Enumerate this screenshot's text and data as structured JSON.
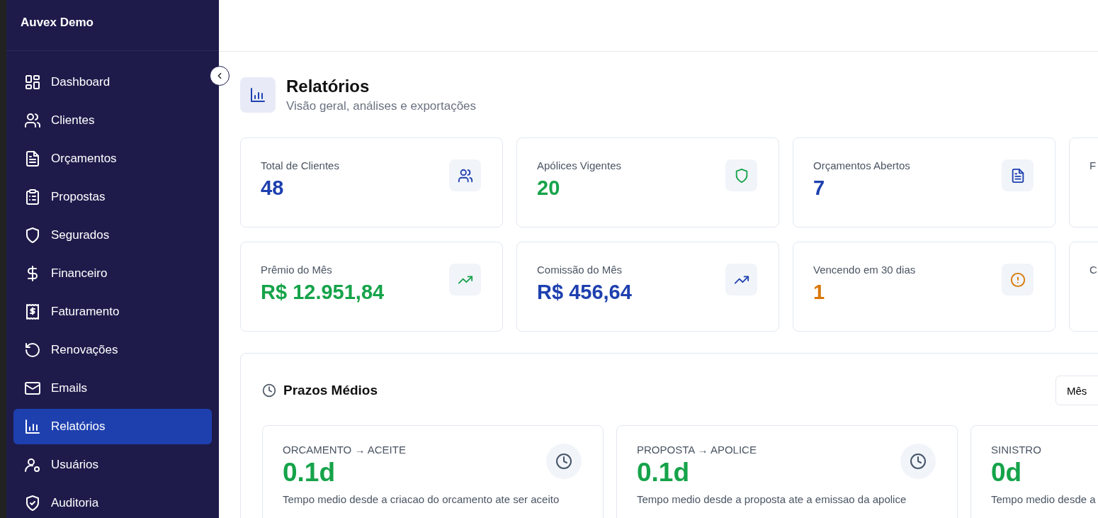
{
  "sidebar": {
    "brand": "Auvex Demo",
    "items": [
      {
        "label": "Dashboard",
        "selected": false
      },
      {
        "label": "Clientes",
        "selected": false
      },
      {
        "label": "Orçamentos",
        "selected": false
      },
      {
        "label": "Propostas",
        "selected": false
      },
      {
        "label": "Segurados",
        "selected": false
      },
      {
        "label": "Financeiro",
        "selected": false
      },
      {
        "label": "Faturamento",
        "selected": false
      },
      {
        "label": "Renovações",
        "selected": false
      },
      {
        "label": "Emails",
        "selected": false
      },
      {
        "label": "Relatórios",
        "selected": true
      },
      {
        "label": "Usuários",
        "selected": false
      },
      {
        "label": "Auditoria",
        "selected": false
      }
    ]
  },
  "page": {
    "title": "Relatórios",
    "subtitle": "Visão geral, análises e exportações"
  },
  "stats": [
    {
      "label": "Total de Clientes",
      "value": "48",
      "color": "#1e40af"
    },
    {
      "label": "Apólices Vigentes",
      "value": "20",
      "color": "#16a34a"
    },
    {
      "label": "Orçamentos Abertos",
      "value": "7",
      "color": "#1e40af"
    },
    {
      "label": "F"
    },
    {
      "label": "Prêmio do Mês",
      "value": "R$ 12.951,84",
      "color": "#16a34a"
    },
    {
      "label": "Comissão do Mês",
      "value": "R$ 456,64",
      "color": "#1e40af"
    },
    {
      "label": "Vencendo em 30 dias",
      "value": "1",
      "color": "#d97706"
    },
    {
      "label": "C"
    }
  ],
  "prazos": {
    "title": "Prazos Médios",
    "period": "Mês",
    "cards": [
      {
        "label": "ORCAMENTO → ACEITE",
        "value": "0.1d",
        "description": "Tempo medio desde a criacao do orcamento ate ser aceito"
      },
      {
        "label": "PROPOSTA → APOLICE",
        "value": "0.1d",
        "description": "Tempo medio desde a proposta ate a emissao da apolice"
      },
      {
        "label": "SINISTRO",
        "value": "0d",
        "description": "Tempo medio desde a"
      }
    ]
  }
}
